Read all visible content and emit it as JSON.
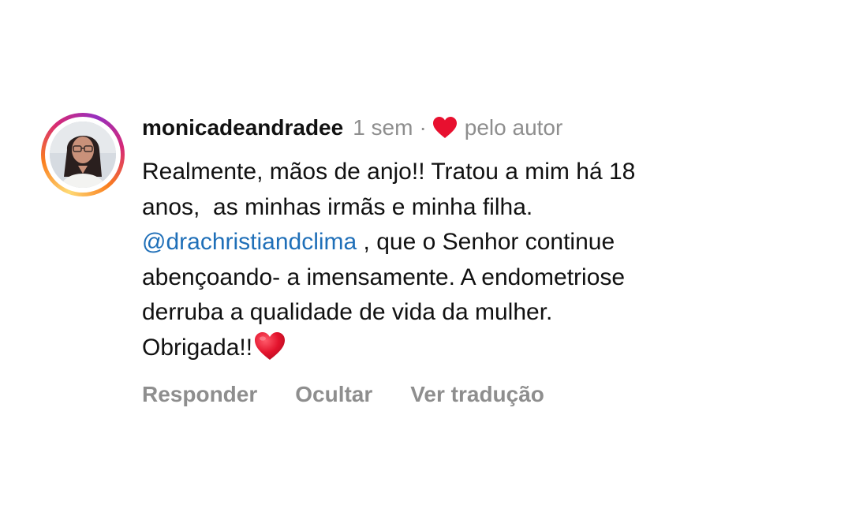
{
  "comment": {
    "username": "monicadeandradee",
    "time": "1 sem",
    "separator": "·",
    "liked_by_label": "pelo autor",
    "text_lines": [
      "Realmente, mãos de anjo!! Tratou a mim há 18",
      "anos,  as minhas irmãs e minha filha.",
      "@drachristiandclima",
      " , que o Senhor continue",
      "abençoando- a imensamente. A endometriose",
      "derruba a qualidade de vida da mulher.",
      "Obrigada!!"
    ],
    "actions": {
      "reply": "Responder",
      "hide": "Ocultar",
      "translate": "Ver tradução"
    }
  },
  "colors": {
    "heart": "#e8102f",
    "mention": "#1f6fb8",
    "meta": "#8e8e8e"
  },
  "icons": {
    "author_like": "heart-icon",
    "emoji": "red-heart-emoji"
  }
}
